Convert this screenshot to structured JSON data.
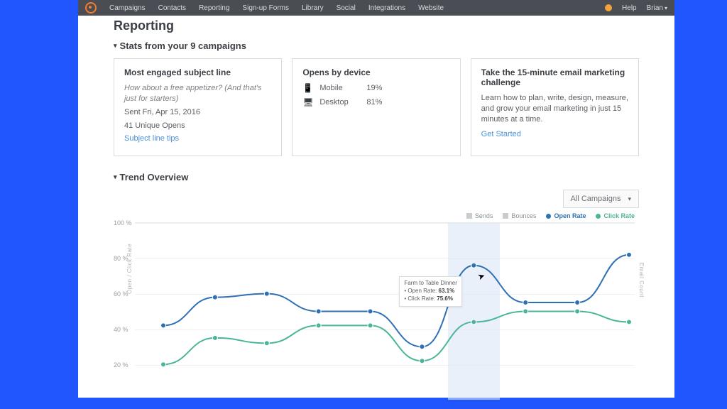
{
  "nav": {
    "items": [
      "Campaigns",
      "Contacts",
      "Reporting",
      "Sign-up Forms",
      "Library",
      "Social",
      "Integrations",
      "Website"
    ],
    "help": "Help",
    "user": "Brian"
  },
  "page_title": "Reporting",
  "section1_title": "Stats from your 9 campaigns",
  "card_engaged": {
    "heading": "Most engaged subject line",
    "subject": "How about a free appetizer? (And that's just for starters)",
    "sent": "Sent Fri, Apr 15, 2016",
    "opens": "41 Unique Opens",
    "link": "Subject line tips"
  },
  "card_device": {
    "heading": "Opens by device",
    "rows": [
      {
        "icon": "📱",
        "name": "Mobile",
        "pct": "19%"
      },
      {
        "icon": "🖥",
        "name": "Desktop",
        "pct": "81%"
      }
    ]
  },
  "card_challenge": {
    "heading": "Take the 15-minute email marketing challenge",
    "body": "Learn how to plan, write, design, measure, and grow your email marketing in just 15 minutes at a time.",
    "link": "Get Started"
  },
  "section2_title": "Trend Overview",
  "filter": "All Campaigns",
  "legend": {
    "sends": "Sends",
    "bounces": "Bounces",
    "open": "Open Rate",
    "click": "Click Rate"
  },
  "axis": {
    "left": "Open / Click Rate",
    "right": "Email Count",
    "ticks": [
      "100 %",
      "80 %",
      "60 %",
      "40 %",
      "20 %"
    ]
  },
  "tooltip": {
    "title": "Farm to Table Dinner",
    "open_label": "Open Rate:",
    "open_val": "63.1%",
    "click_label": "Click Rate:",
    "click_val": "75.6%"
  },
  "chart_data": {
    "type": "line",
    "xlabel": "",
    "ylabel": "Open / Click Rate",
    "ylim": [
      0,
      100
    ],
    "x": [
      1,
      2,
      3,
      4,
      5,
      6,
      7,
      8,
      9,
      10
    ],
    "series": [
      {
        "name": "Open Rate",
        "color": "#2f6fb3",
        "values": [
          42,
          58,
          60,
          50,
          50,
          30,
          76,
          55,
          55,
          82
        ]
      },
      {
        "name": "Click Rate",
        "color": "#4bb59a",
        "values": [
          20,
          35,
          32,
          42,
          42,
          22,
          44,
          50,
          50,
          44
        ]
      }
    ],
    "highlight_index": 6,
    "tooltip_point": {
      "title": "Farm to Table Dinner",
      "open": 63.1,
      "click": 75.6
    }
  }
}
